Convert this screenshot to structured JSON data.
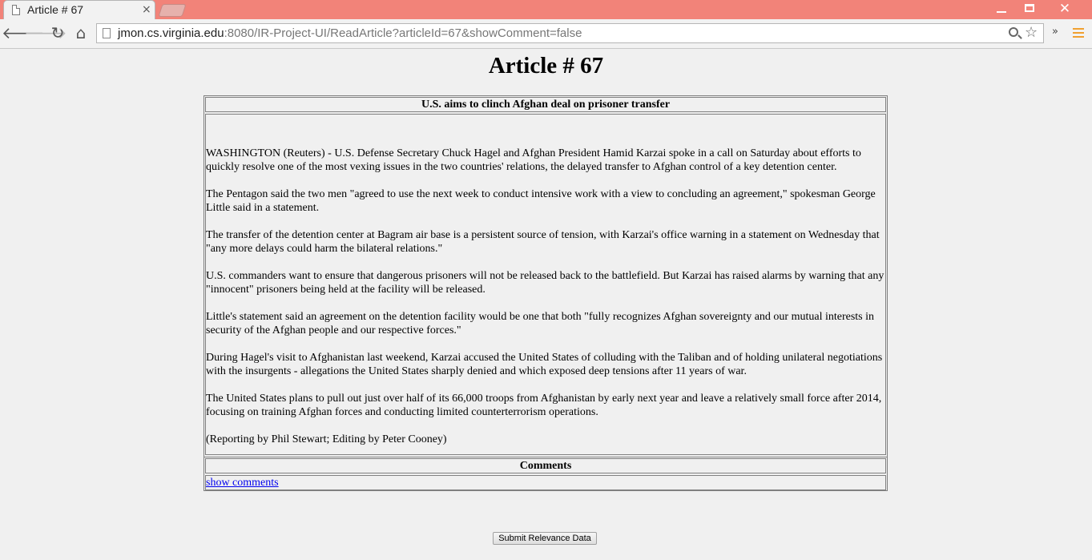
{
  "browser": {
    "tab_title": "Article # 67",
    "tab_close": "×",
    "url_host": "jmon.cs.virginia.edu",
    "url_rest": ":8080/IR-Project-UI/ReadArticle?articleId=67&showComment=false",
    "nav": {
      "back": "🡐",
      "forward": "🡒",
      "reload": "↻",
      "home": "⌂"
    },
    "star": "☆",
    "extensions": "»",
    "window_close": "✕"
  },
  "page": {
    "title": "Article # 67",
    "headline": "U.S. aims to clinch Afghan deal on prisoner transfer",
    "paragraphs": [
      "WASHINGTON (Reuters) - U.S. Defense Secretary Chuck Hagel and Afghan President Hamid Karzai spoke in a call on Saturday about efforts to quickly resolve one of the most vexing issues in the two countries' relations, the delayed transfer to Afghan control of a key detention center.",
      "The Pentagon said the two men \"agreed to use the next week to conduct intensive work with a view to concluding an agreement,\" spokesman George Little said in a statement.",
      "The transfer of the detention center at Bagram air base is a persistent source of tension, with Karzai's office warning in a statement on Wednesday that \"any more delays could harm the bilateral relations.\"",
      "U.S. commanders want to ensure that dangerous prisoners will not be released back to the battlefield. But Karzai has raised alarms by warning that any \"innocent\" prisoners being held at the facility will be released.",
      "Little's statement said an agreement on the detention facility would be one that both \"fully recognizes Afghan sovereignty and our mutual interests in security of the Afghan people and our respective forces.\"",
      "During Hagel's visit to Afghanistan last weekend, Karzai accused the United States of colluding with the Taliban and of holding unilateral negotiations with the insurgents - allegations the United States sharply denied and which exposed deep tensions after 11 years of war.",
      "The United States plans to pull out just over half of its 66,000 troops from Afghanistan by early next year and leave a relatively small force after 2014, focusing on training Afghan forces and conducting limited counterterrorism operations.",
      "(Reporting by Phil Stewart; Editing by Peter Cooney)"
    ],
    "comments_header": "Comments",
    "show_comments_link": "show comments",
    "submit_label": "Submit Relevance Data"
  }
}
